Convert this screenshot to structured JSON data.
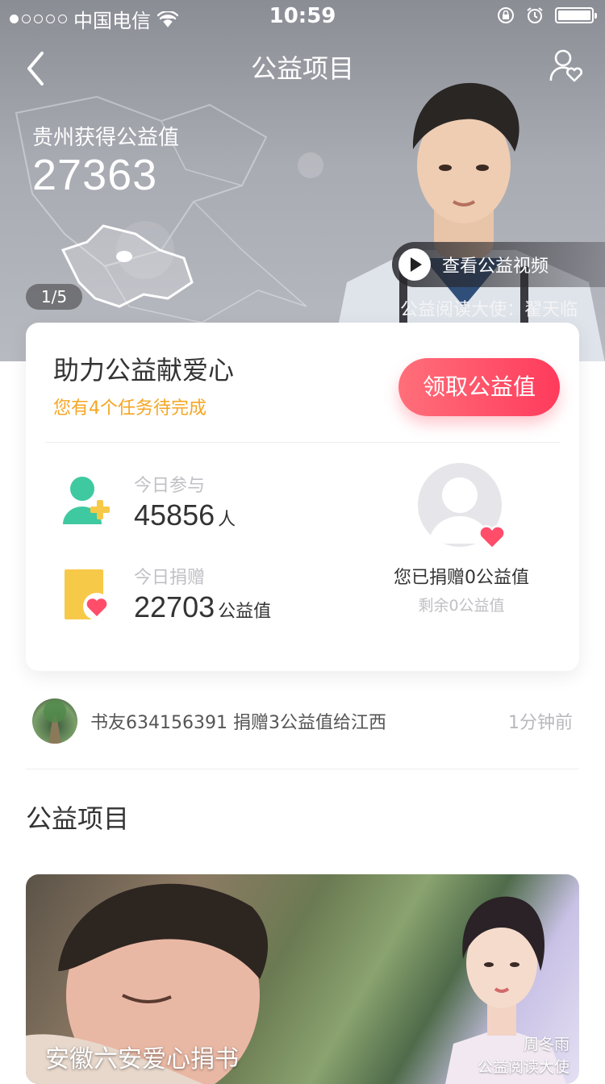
{
  "status_bar": {
    "carrier": "中国电信",
    "time": "10:59"
  },
  "nav": {
    "title": "公益项目"
  },
  "hero": {
    "label": "贵州获得公益值",
    "value": "27363",
    "pager": "1/5",
    "video_label": "查看公益视频",
    "ambassador": "公益阅读大使：翟天临"
  },
  "card": {
    "title": "助力公益献爱心",
    "subtitle": "您有4个任务待完成",
    "claim_button": "领取公益值",
    "today_join_label": "今日参与",
    "today_join_value": "45856",
    "today_join_unit": "人",
    "today_donate_label": "今日捐赠",
    "today_donate_value": "22703",
    "today_donate_unit": "公益值",
    "donated_text": "您已捐赠0公益值",
    "remain_text": "剩余0公益值"
  },
  "feed": {
    "text": "书友634156391 捐赠3公益值给江西",
    "time": "1分钟前"
  },
  "section": {
    "title": "公益项目"
  },
  "banner": {
    "title": "安徽六安爱心捐书",
    "name": "周冬雨",
    "role": "公益阅读大使"
  },
  "colors": {
    "accent": "#ff3b5c",
    "subtitle": "#f5a623",
    "icon_green": "#3fc9a0",
    "icon_yellow": "#f7c948",
    "heart": "#ff4d6a"
  }
}
